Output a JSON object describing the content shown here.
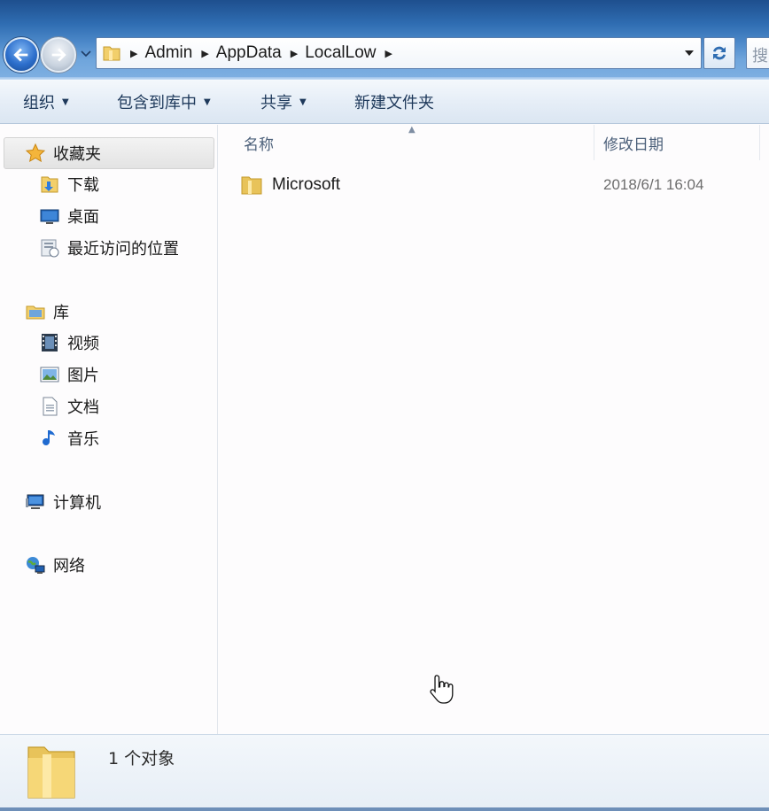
{
  "address_bar": {
    "breadcrumbs": [
      "Admin",
      "AppData",
      "LocalLow"
    ],
    "search_placeholder": "搜"
  },
  "toolbar": {
    "organize": "组织",
    "include_in_library": "包含到库中",
    "share": "共享",
    "new_folder": "新建文件夹"
  },
  "navigation": {
    "favorites": {
      "label": "收藏夹",
      "items": [
        {
          "label": "下载",
          "icon": "download-folder-icon"
        },
        {
          "label": "桌面",
          "icon": "desktop-icon"
        },
        {
          "label": "最近访问的位置",
          "icon": "recent-places-icon"
        }
      ]
    },
    "libraries": {
      "label": "库",
      "items": [
        {
          "label": "视频",
          "icon": "video-icon"
        },
        {
          "label": "图片",
          "icon": "pictures-icon"
        },
        {
          "label": "文档",
          "icon": "documents-icon"
        },
        {
          "label": "音乐",
          "icon": "music-icon"
        }
      ]
    },
    "computer": {
      "label": "计算机",
      "icon": "computer-icon"
    },
    "network": {
      "label": "网络",
      "icon": "network-icon"
    }
  },
  "file_list": {
    "columns": [
      "名称",
      "修改日期"
    ],
    "rows": [
      {
        "name": "Microsoft",
        "modified": "2018/6/1 16:04",
        "icon": "folder-icon"
      }
    ]
  },
  "status": {
    "item_count": "1 个对象"
  },
  "colors": {
    "window_accent": "#2f6db2",
    "folder": "#e8c35a"
  }
}
